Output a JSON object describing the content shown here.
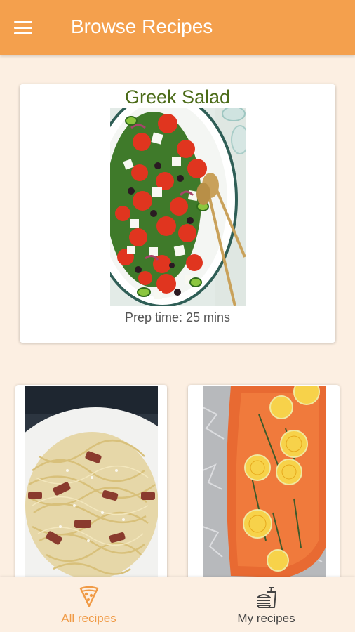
{
  "app_bar": {
    "title": "Browse Recipes",
    "menu_icon": "menu-icon",
    "background": "#f4a04d"
  },
  "featured": {
    "title": "Greek Salad",
    "prep_time": "Prep time: 25 mins",
    "image_subject": "greek salad on oval platter"
  },
  "recipe_grid": [
    {
      "image_subject": "spaghetti carbonara with bacon"
    },
    {
      "image_subject": "baked salmon with lemon slices and rosemary on foil"
    }
  ],
  "bottom_nav": {
    "items": [
      {
        "label": "All recipes",
        "icon": "pizza-slice-icon",
        "active": true
      },
      {
        "label": "My recipes",
        "icon": "burger-drink-icon",
        "active": false
      }
    ],
    "active_color": "#f09a45"
  }
}
